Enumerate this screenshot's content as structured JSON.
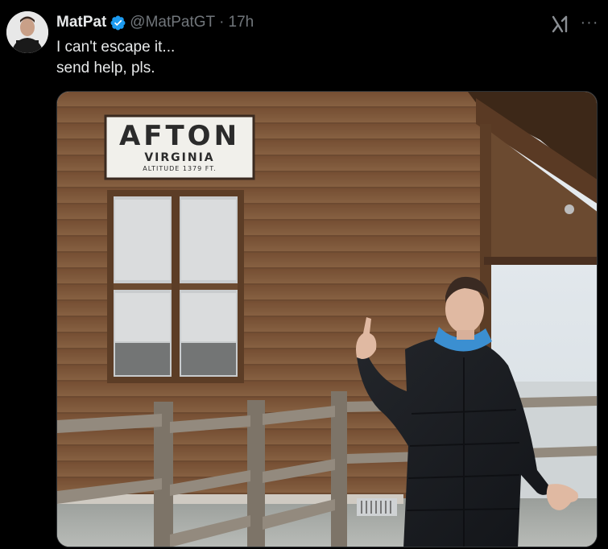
{
  "author": {
    "display_name": "MatPat",
    "handle": "@MatPatGT",
    "separator": "·",
    "timestamp": "17h",
    "avatar_icon": "profile-photo",
    "verified_icon": "verified-badge-icon"
  },
  "actions": {
    "grok_icon": "grok-icon",
    "more_icon": "more-options-icon",
    "more_glyph": "···"
  },
  "tweet": {
    "lines": [
      "I can't escape it...",
      "send help, pls."
    ]
  },
  "media": {
    "sign": {
      "line1": "AFTON",
      "line2": "VIRGINIA",
      "line3": "ALTITUDE 1379 FT."
    }
  },
  "colors": {
    "background": "#000000",
    "text": "#e7e9ea",
    "muted": "#71767b",
    "verified": "#1d9bf0"
  }
}
